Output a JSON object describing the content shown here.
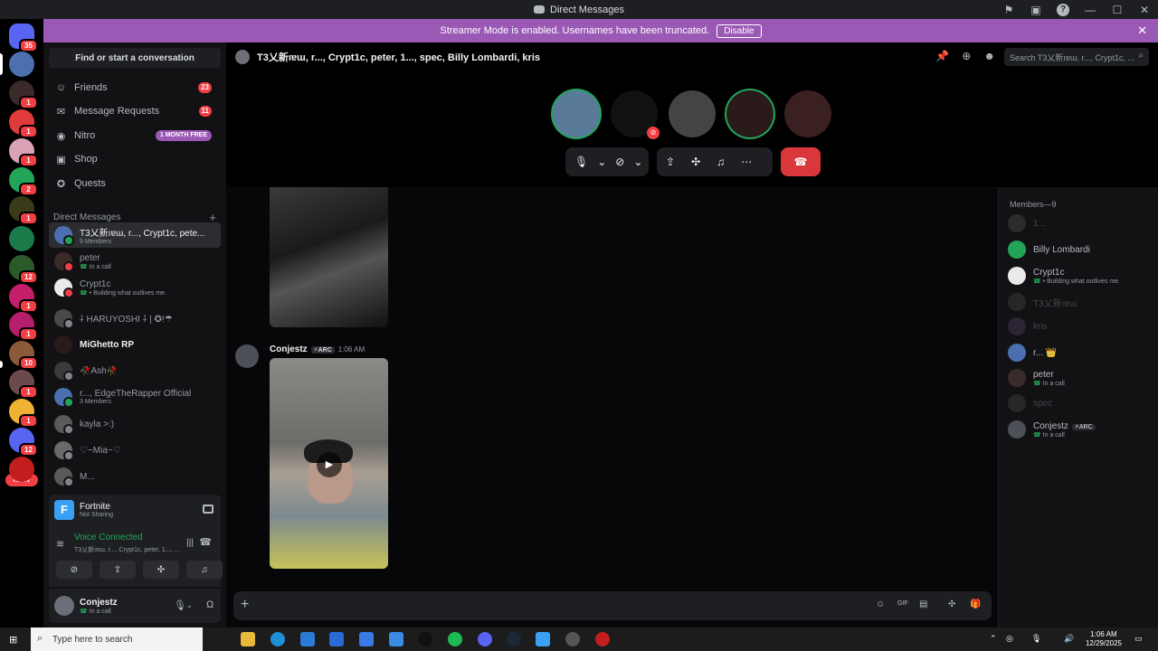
{
  "window": {
    "title": "Direct Messages"
  },
  "banner": {
    "text": "Streamer Mode is enabled. Usernames have been truncated.",
    "button": "Disable"
  },
  "rail": {
    "guilds": [
      {
        "badge": "35",
        "color": "#5865f2"
      },
      {
        "badge": "",
        "color": "#4c6fb0"
      },
      {
        "badge": "1",
        "color": "#3a2a2a"
      },
      {
        "badge": "1",
        "color": "#e03a3a"
      },
      {
        "badge": "1",
        "color": "#d9a3b5"
      },
      {
        "badge": "2",
        "color": "#23a559"
      },
      {
        "badge": "1",
        "color": "#3a3a1a"
      },
      {
        "badge": "",
        "color": "#1a7a4a"
      },
      {
        "badge": "12",
        "color": "#2a5a2a"
      },
      {
        "badge": "1",
        "color": "#c21e6a"
      },
      {
        "badge": "1",
        "color": "#b51e6a"
      },
      {
        "badge": "10",
        "color": "#8a5a3a"
      },
      {
        "badge": "1",
        "color": "#6a4a4a"
      },
      {
        "badge": "1",
        "color": "#f0b232"
      },
      {
        "badge": "12",
        "color": "#5865f2"
      },
      {
        "badge": "",
        "color": "#c21e1e"
      }
    ],
    "new_label": "NEW"
  },
  "sidebar": {
    "find_label": "Find or start a conversation",
    "nav": [
      {
        "label": "Friends",
        "icon": "friends-icon",
        "glyph": "☺",
        "count": "23"
      },
      {
        "label": "Message Requests",
        "icon": "mail-icon",
        "glyph": "✉",
        "count": "11"
      },
      {
        "label": "Nitro",
        "icon": "nitro-icon",
        "glyph": "◉",
        "tag": "1 MONTH FREE"
      },
      {
        "label": "Shop",
        "icon": "shop-icon",
        "glyph": "▣"
      },
      {
        "label": "Quests",
        "icon": "quests-icon",
        "glyph": "✪"
      }
    ],
    "dm_header": "Direct Messages",
    "dms": [
      {
        "name": "T3乂新ıɐɯ, r..., Crypt1c, pete...",
        "sub": "9 Members",
        "call": false,
        "active": true,
        "bold": false,
        "color": "#4c6fb0",
        "status": "#23a559"
      },
      {
        "name": "peter",
        "sub": "In a call",
        "call": true,
        "active": false,
        "bold": false,
        "color": "#3a2a2a",
        "status": "#f23f43"
      },
      {
        "name": "Crypt1c",
        "sub": "• Building what outlives me.",
        "call": true,
        "active": false,
        "bold": false,
        "color": "#eaeaea",
        "status": "#f23f43"
      },
      {
        "name": "⸸ HARUYOSHI ⸸ | ✪!☂",
        "sub": "",
        "call": false,
        "active": false,
        "bold": false,
        "color": "#4a4a4a",
        "status": "#80848e"
      },
      {
        "name": "MiGhetto RP",
        "sub": "",
        "call": false,
        "active": false,
        "bold": true,
        "color": "#2a1a1a",
        "status": ""
      },
      {
        "name": "🥀Ash🥀",
        "sub": "",
        "call": false,
        "active": false,
        "bold": false,
        "color": "#3a3a3a",
        "status": "#80848e"
      },
      {
        "name": "r..., EdgeTheRapper Official",
        "sub": "3 Members",
        "call": false,
        "active": false,
        "bold": false,
        "color": "#4c6fb0",
        "status": "#23a559"
      },
      {
        "name": "kayla >:)",
        "sub": "",
        "call": false,
        "active": false,
        "bold": false,
        "color": "#5a5a5a",
        "status": "#80848e"
      },
      {
        "name": "♡~Mia~♡",
        "sub": "",
        "call": false,
        "active": false,
        "bold": false,
        "color": "#6a6a6a",
        "status": "#80848e"
      },
      {
        "name": "M...",
        "sub": "",
        "call": false,
        "active": false,
        "bold": false,
        "color": "#5a5a5a",
        "status": "#80848e"
      }
    ]
  },
  "activity": {
    "game": "Fortnite",
    "status": "Not Sharing",
    "icon_letter": "F"
  },
  "voice": {
    "status": "Voice Connected",
    "channel": "T3乂新ıɐɯ, r..., Crypt1c, peter, 1..., spec..."
  },
  "user": {
    "name": "Conjestz",
    "status": "In a call"
  },
  "header": {
    "title": "T3乂新ıɐɯ, r..., Crypt1c, peter, 1..., spec, Billy Lombardi, kris",
    "search_placeholder": "Search T3乂新ıɐɯ, r..., Crypt1c, ..."
  },
  "call": {
    "tiles": [
      {
        "color": "#5a7a9a",
        "speaking": true,
        "muted": false
      },
      {
        "color": "#111111",
        "speaking": false,
        "muted": true
      },
      {
        "color": "#444444",
        "speaking": false,
        "muted": false
      },
      {
        "color": "#2a1a1a",
        "speaking": true,
        "muted": false
      },
      {
        "color": "#3a2020",
        "speaking": false,
        "muted": false
      }
    ]
  },
  "message": {
    "author": "Conjestz",
    "tag": "ARC",
    "time": "1:06 AM"
  },
  "members": {
    "header": "Members—9",
    "list": [
      {
        "name": "1...",
        "sub": "",
        "tag": "",
        "dim": true,
        "color": "#6a6a6a"
      },
      {
        "name": "Billy Lombardi",
        "sub": "",
        "tag": "",
        "dim": false,
        "color": "#23a559"
      },
      {
        "name": "Crypt1c",
        "sub": "• Building what outlives me.",
        "tag": "",
        "dim": false,
        "color": "#eaeaea"
      },
      {
        "name": "T3乂新ıɐɯ",
        "sub": "",
        "tag": "",
        "dim": true,
        "color": "#5a5a5a"
      },
      {
        "name": "kris",
        "sub": "",
        "tag": "",
        "dim": true,
        "color": "#6a4a7a"
      },
      {
        "name": "r... 👑",
        "sub": "",
        "tag": "",
        "dim": false,
        "color": "#4c6fb0"
      },
      {
        "name": "peter",
        "sub": "In a call",
        "tag": "",
        "dim": false,
        "color": "#3a2a2a"
      },
      {
        "name": "spec",
        "sub": "",
        "tag": "",
        "dim": true,
        "color": "#5a5a5a"
      },
      {
        "name": "Conjestz",
        "sub": "In a call",
        "tag": "ARC",
        "dim": false,
        "color": "#4e5058"
      }
    ]
  },
  "taskbar": {
    "search_placeholder": "Type here to search",
    "time": "1:06 AM",
    "date": "12/29/2025"
  }
}
